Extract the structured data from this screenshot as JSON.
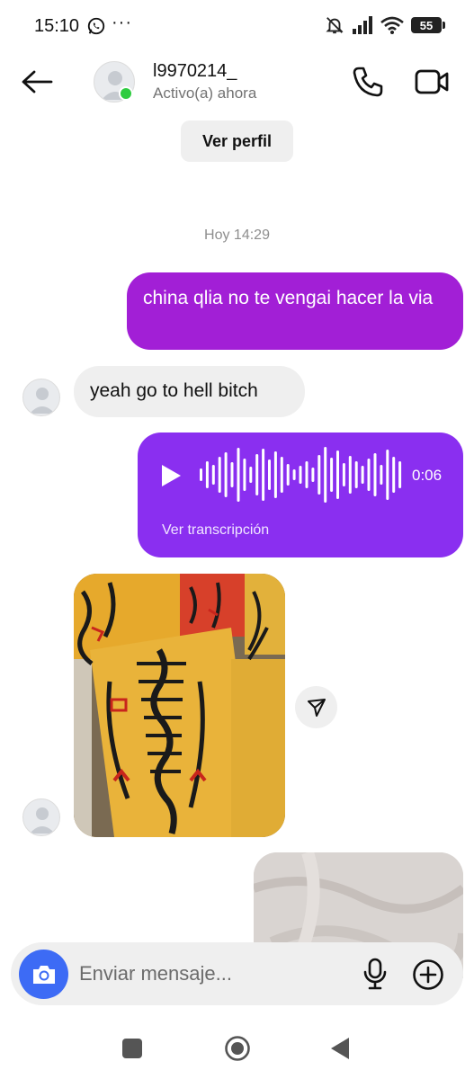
{
  "status_bar": {
    "time": "15:10",
    "more": "···",
    "battery": "55"
  },
  "header": {
    "username": "l9970214_",
    "status": "Activo(a) ahora",
    "view_profile": "Ver perfil"
  },
  "chat": {
    "date_separator": "Hoy 14:29",
    "messages": [
      {
        "direction": "outgoing",
        "type": "text",
        "text": "china qlia no te vengai hacer la via"
      },
      {
        "direction": "incoming",
        "type": "text",
        "text": "yeah go to hell bitch"
      },
      {
        "direction": "outgoing",
        "type": "voice",
        "duration": "0:06",
        "transcript_label": "Ver transcripción"
      },
      {
        "direction": "incoming",
        "type": "image"
      },
      {
        "direction": "outgoing",
        "type": "image"
      }
    ]
  },
  "composer": {
    "placeholder": "Enviar mensaje..."
  },
  "colors": {
    "outgoing_text_bubble": "#a21fd6",
    "outgoing_voice_bubble": "#8a2ff0",
    "incoming_bubble": "#efefef",
    "camera_button": "#3d6bf5",
    "online": "#2ecc40"
  },
  "icons": [
    "whatsapp-icon",
    "mute-bell-icon",
    "signal-icon",
    "wifi-icon",
    "battery-icon",
    "back-arrow-icon",
    "phone-icon",
    "video-camera-icon",
    "play-icon",
    "share-icon",
    "camera-icon",
    "microphone-icon",
    "plus-icon",
    "nav-recents-icon",
    "nav-home-icon",
    "nav-back-icon"
  ]
}
